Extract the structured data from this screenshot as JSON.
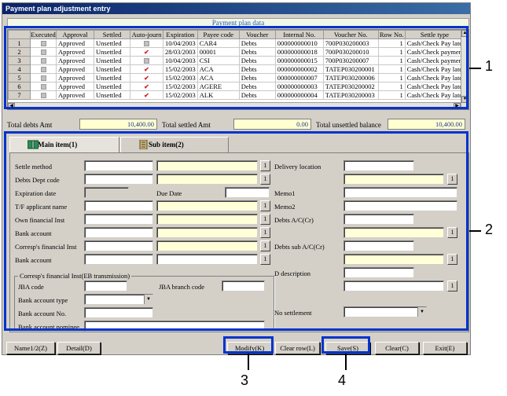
{
  "window": {
    "title": "Payment plan adjustment entry"
  },
  "grid": {
    "caption": "Payment plan data",
    "columns": [
      "",
      "Executed",
      "Approval",
      "Settled",
      "Auto-journ",
      "Expiration",
      "Payee code",
      "Voucher",
      "Internal No.",
      "Voucher No.",
      "Row No.",
      "Settle type"
    ],
    "rows": [
      {
        "n": "1",
        "executed": false,
        "approval": "Approved",
        "settled": "Unsettled",
        "autojourn": false,
        "expiration": "10/04/2003",
        "payee": "CAR4",
        "voucher": "Debts",
        "internal": "000000000010",
        "voucher_no": "700P030200003",
        "row_no": "1",
        "settle_type": "Cash/Check Pay late"
      },
      {
        "n": "2",
        "executed": false,
        "approval": "Approved",
        "settled": "Unsettled",
        "autojourn": true,
        "expiration": "28/03/2003",
        "payee": "00001",
        "voucher": "Debts",
        "internal": "000000000018",
        "voucher_no": "700P030200010",
        "row_no": "1",
        "settle_type": "Cash/Check paymen"
      },
      {
        "n": "3",
        "executed": false,
        "approval": "Approved",
        "settled": "Unsettled",
        "autojourn": false,
        "expiration": "10/04/2003",
        "payee": "CSI",
        "voucher": "Debts",
        "internal": "000000000015",
        "voucher_no": "700P030200007",
        "row_no": "1",
        "settle_type": "Cash/Check paymen"
      },
      {
        "n": "4",
        "executed": false,
        "approval": "Approved",
        "settled": "Unsettled",
        "autojourn": true,
        "expiration": "15/02/2003",
        "payee": "ACA",
        "voucher": "Debts",
        "internal": "000000000002",
        "voucher_no": "TATEP030200001",
        "row_no": "1",
        "settle_type": "Cash/Check Pay late"
      },
      {
        "n": "5",
        "executed": false,
        "approval": "Approved",
        "settled": "Unsettled",
        "autojourn": true,
        "expiration": "15/02/2003",
        "payee": "ACA",
        "voucher": "Debts",
        "internal": "000000000007",
        "voucher_no": "TATEP030200006",
        "row_no": "1",
        "settle_type": "Cash/Check Pay late"
      },
      {
        "n": "6",
        "executed": false,
        "approval": "Approved",
        "settled": "Unsettled",
        "autojourn": true,
        "expiration": "15/02/2003",
        "payee": "AGERE",
        "voucher": "Debts",
        "internal": "000000000003",
        "voucher_no": "TATEP030200002",
        "row_no": "1",
        "settle_type": "Cash/Check Pay late"
      },
      {
        "n": "7",
        "executed": false,
        "approval": "Approved",
        "settled": "Unsettled",
        "autojourn": true,
        "expiration": "15/02/2003",
        "payee": "ALK",
        "voucher": "Debts",
        "internal": "000000000004",
        "voucher_no": "TATEP030200003",
        "row_no": "1",
        "settle_type": "Cash/Check Pay late"
      }
    ]
  },
  "totals": {
    "debts_label": "Total debts Amt",
    "debts_value": "10,400.00",
    "settled_label": "Total settled Amt",
    "settled_value": "0.00",
    "unsettled_label": "Total unsettled balance",
    "unsettled_value": "10,400.00"
  },
  "tabs": {
    "main": "Main item(1)",
    "sub": "Sub item(2)"
  },
  "form": {
    "settle_method": "Settle method",
    "debts_dept_code": "Debts Dept code",
    "expiration_date": "Expiration date",
    "due_date": "Due Date",
    "tf_applicant": "T/F applicant name",
    "own_fin_inst": "Own financial Inst",
    "bank_account": "Bank account",
    "corresp_fin_inst": "Corresp's financial Inst",
    "bank_account2": "Bank account",
    "group_title": "Corresp's financial Inst(EB transmission)",
    "jba_code": "JBA code",
    "jba_branch_code": "JBA branch code",
    "bank_account_type": "Bank account type",
    "bank_account_no": "Bank account No.",
    "bank_account_nominee": "Bank account nominee",
    "delivery_location": "Delivery location",
    "memo1": "Memo1",
    "memo2": "Memo2",
    "debts_ac": "Debts A/C(Cr)",
    "debts_sub_ac": "Debts sub A/C(Cr)",
    "d_description": "D description",
    "no_settlement": "No settlement",
    "one": "1"
  },
  "buttons": {
    "name12": "Name1/2(Z)",
    "detail": "Detail(D)",
    "modify": "Modify(K)",
    "clear_row": "Clear row(L)",
    "save": "Save(S)",
    "clear": "Clear(C)",
    "exit": "Exit(E)"
  },
  "callouts": {
    "c1": "1",
    "c2": "2",
    "c3": "3",
    "c4": "4"
  },
  "colors": {
    "highlight": "#0033cc",
    "titlebar": "#0a246a",
    "readonly_field": "#ffffd8"
  }
}
